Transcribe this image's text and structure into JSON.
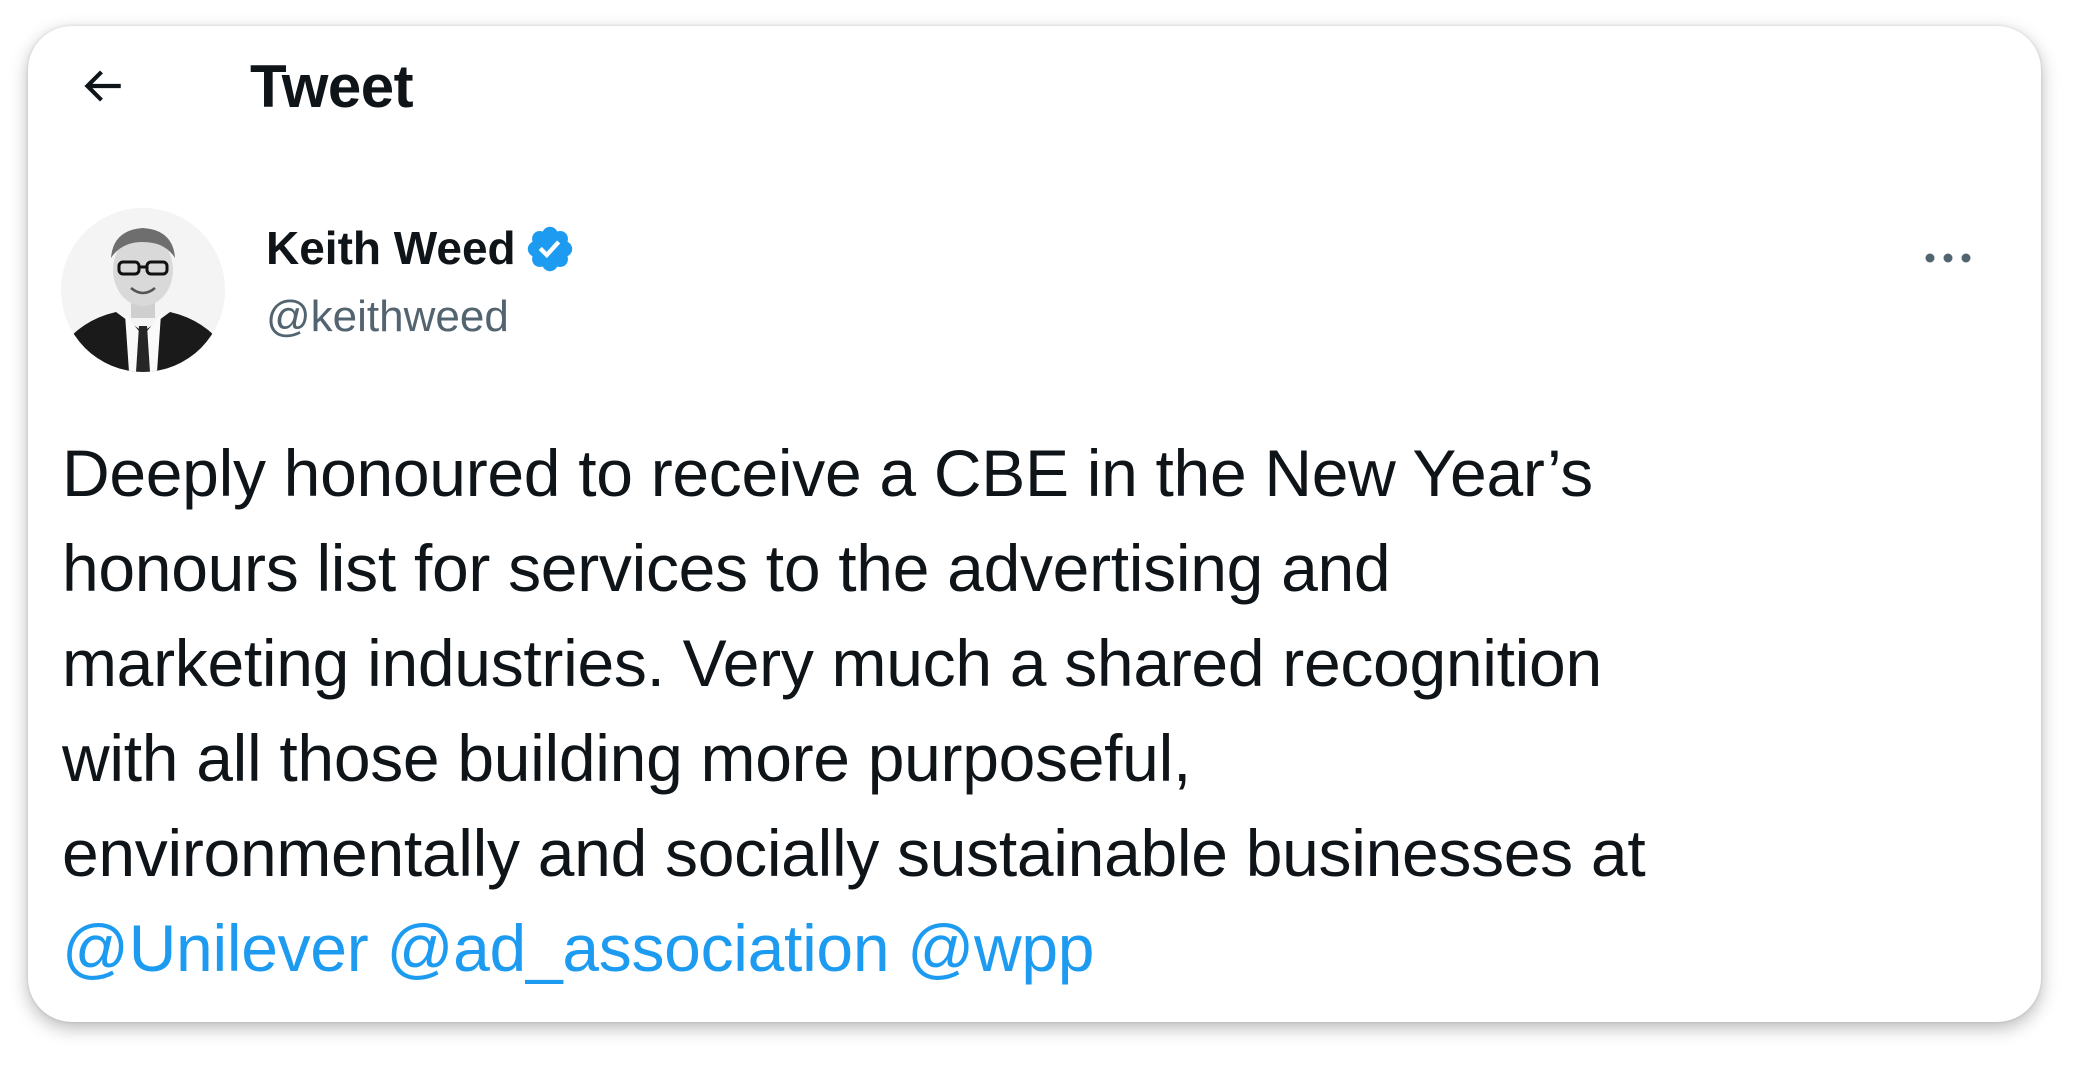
{
  "header": {
    "title": "Tweet",
    "back_icon": "arrow-left-icon"
  },
  "tweet": {
    "author": {
      "name": "Keith Weed",
      "handle": "@keithweed",
      "verified": true,
      "verified_icon": "verified-badge-icon"
    },
    "more_icon": "ellipsis-icon",
    "text_lines": [
      "Deeply honoured to receive a CBE in the New Year’s",
      "honours list for services to the advertising and",
      "marketing industries. Very much a shared recognition",
      "with all those building more purposeful,",
      "environmentally and socially sustainable businesses at"
    ],
    "mentions": [
      "@Unilever",
      "@ad_association",
      "@wpp"
    ]
  },
  "colors": {
    "text_primary": "#0f1419",
    "text_secondary": "#536471",
    "accent": "#1d9bf0"
  }
}
